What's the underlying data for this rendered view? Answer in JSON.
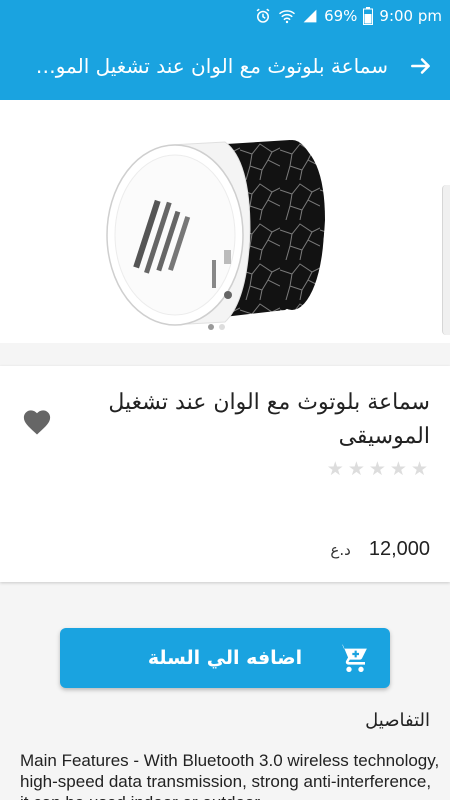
{
  "status_bar": {
    "battery": "69%",
    "time": "9:00 pm"
  },
  "app_bar": {
    "title": "سماعة بلوتوث مع الوان عند تشغيل الموسيقى"
  },
  "product": {
    "name": "سماعة بلوتوث مع الوان عند تشغيل الموسيقى",
    "rating": 0,
    "rating_max": 5,
    "price_amount": "12,000",
    "price_currency": "د.ع",
    "favorite": false,
    "image_count": 2,
    "active_image": 0
  },
  "actions": {
    "add_to_cart": "اضافه الي السلة"
  },
  "details": {
    "heading": "التفاصيل",
    "text": "Main Features - With Bluetooth 3.0 wireless technology, high-speed data transmission, strong anti-interference, it can be used indoor or outdoor"
  },
  "colors": {
    "primary": "#1aa3e0",
    "star_empty": "#dddddd",
    "heart": "#666666"
  }
}
